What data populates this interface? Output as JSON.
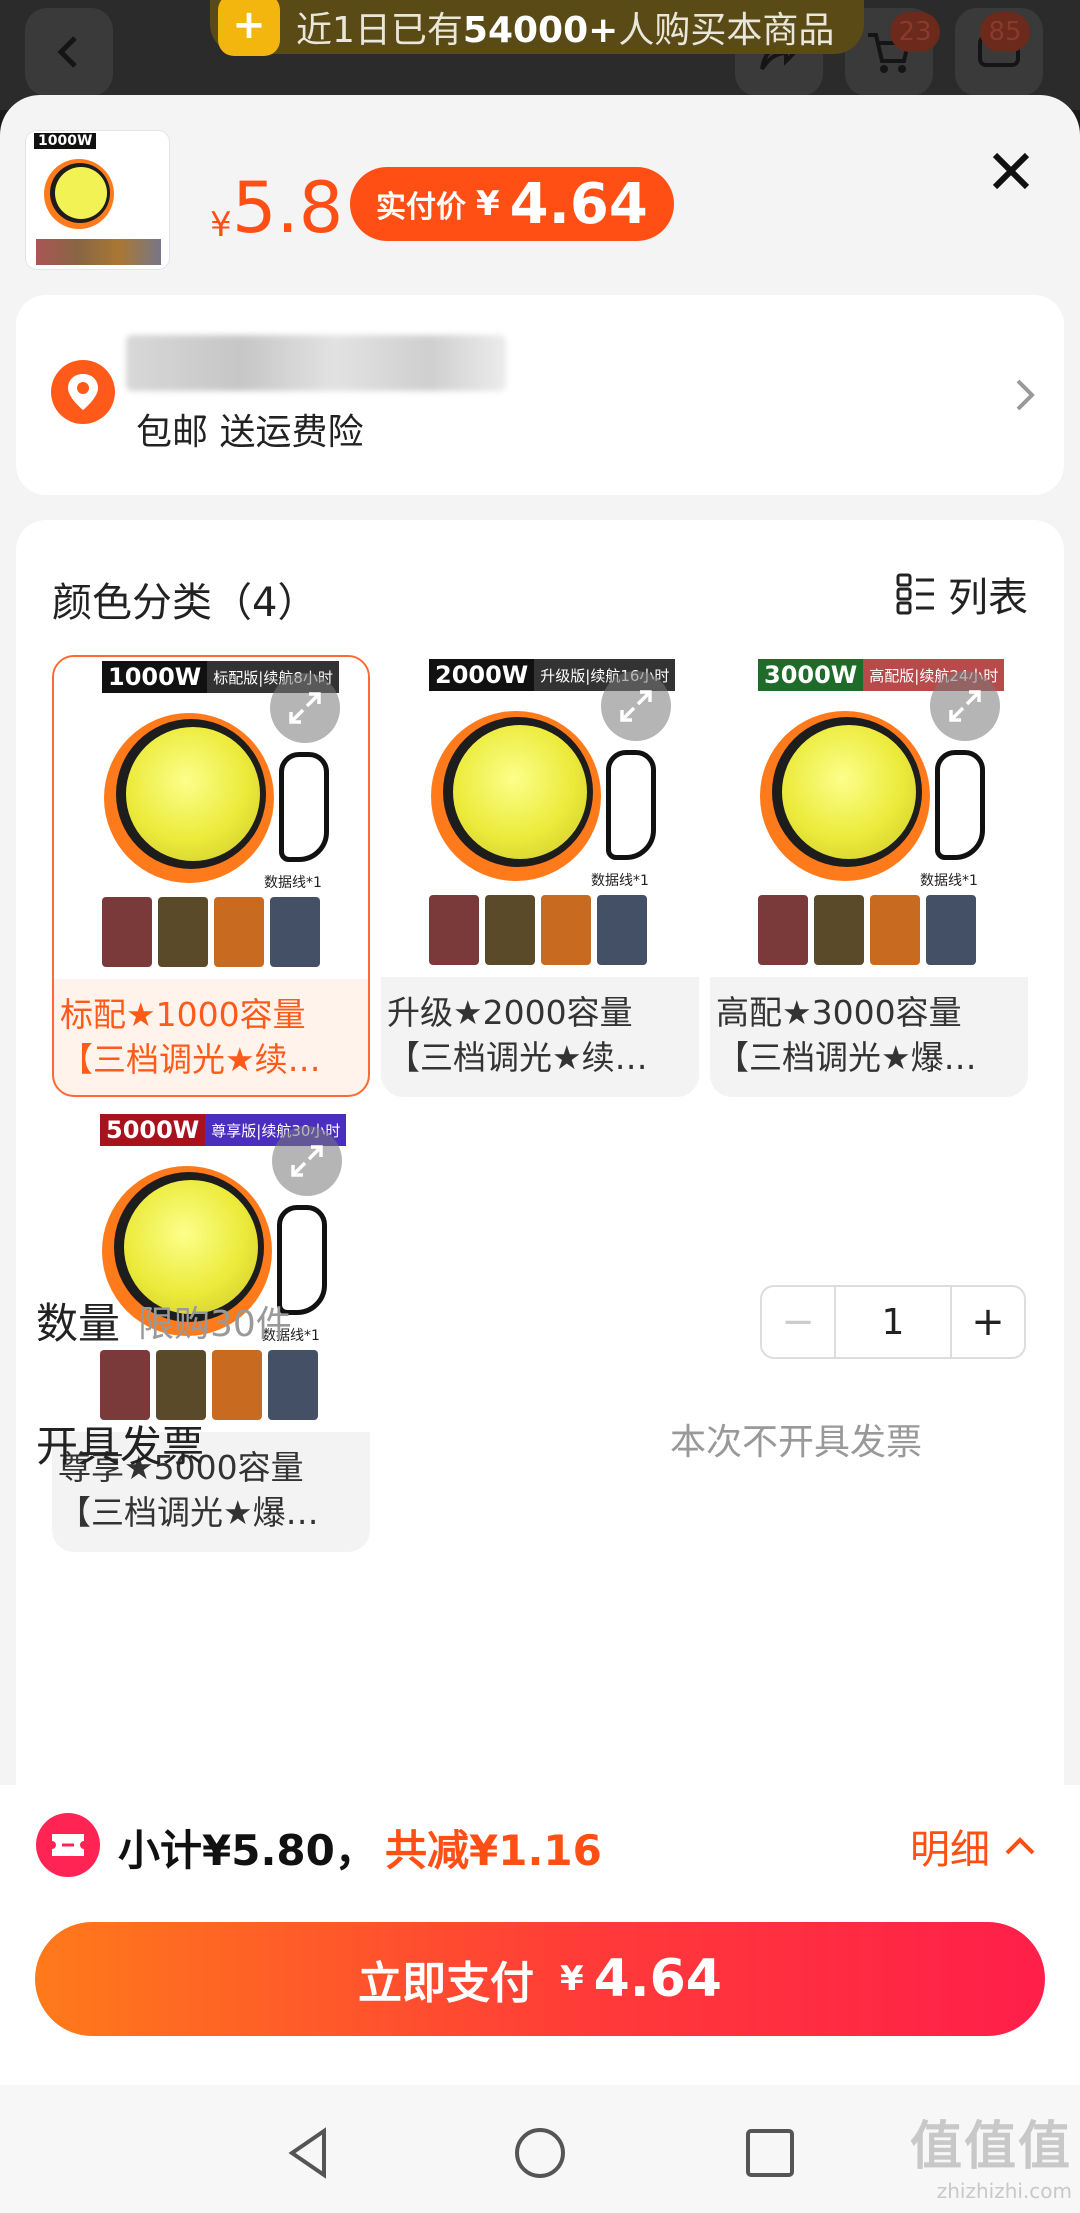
{
  "background": {
    "promo_text_prefix": "近1日已有",
    "promo_count": "54000+",
    "promo_text_suffix": "人购买本商品",
    "cart_badge": "23",
    "msg_badge": "85"
  },
  "header": {
    "currency": "¥",
    "price": "5.8",
    "pay_label": "实付价",
    "pay_currency": "¥",
    "pay_price": "4.64",
    "thumb_tag": "1000W"
  },
  "address": {
    "shipping": "包邮 送运费险"
  },
  "variants": {
    "title": "颜色分类（4）",
    "list_label": "列表",
    "items": [
      {
        "watt": "1000W",
        "desc": "标配版|续航8小时",
        "tag_color": "#333333",
        "line1": "标配★1000容量",
        "line2": "【三档调光★续…"
      },
      {
        "watt": "2000W",
        "desc": "升级版|续航16小时",
        "tag_color": "#333333",
        "line1": "升级★2000容量",
        "line2": "【三档调光★续…"
      },
      {
        "watt": "3000W",
        "desc": "高配版|续航24小时",
        "tag_color": "#1f6b2a",
        "line1": "高配★3000容量",
        "line2": "【三档调光★爆…"
      },
      {
        "watt": "5000W",
        "desc": "尊享版|续航30小时",
        "tag_color": "#4a2fbf",
        "line1": "尊享★5000容量",
        "line2": "【三档调光★爆…"
      }
    ],
    "cable_label": "数据线*1"
  },
  "quantity": {
    "label": "数量",
    "limit": "限购30件",
    "minus": "−",
    "value": "1",
    "plus": "+"
  },
  "invoice": {
    "label": "开具发票",
    "value": "本次不开具发票"
  },
  "footer": {
    "subtotal": "小计¥5.80，",
    "discount": "共减¥1.16",
    "detail": "明细",
    "pay_label": "立即支付",
    "pay_currency": "¥",
    "pay_amount": "4.64"
  },
  "watermark": {
    "big": "值值值",
    "small": "zhizhizhi.com"
  }
}
